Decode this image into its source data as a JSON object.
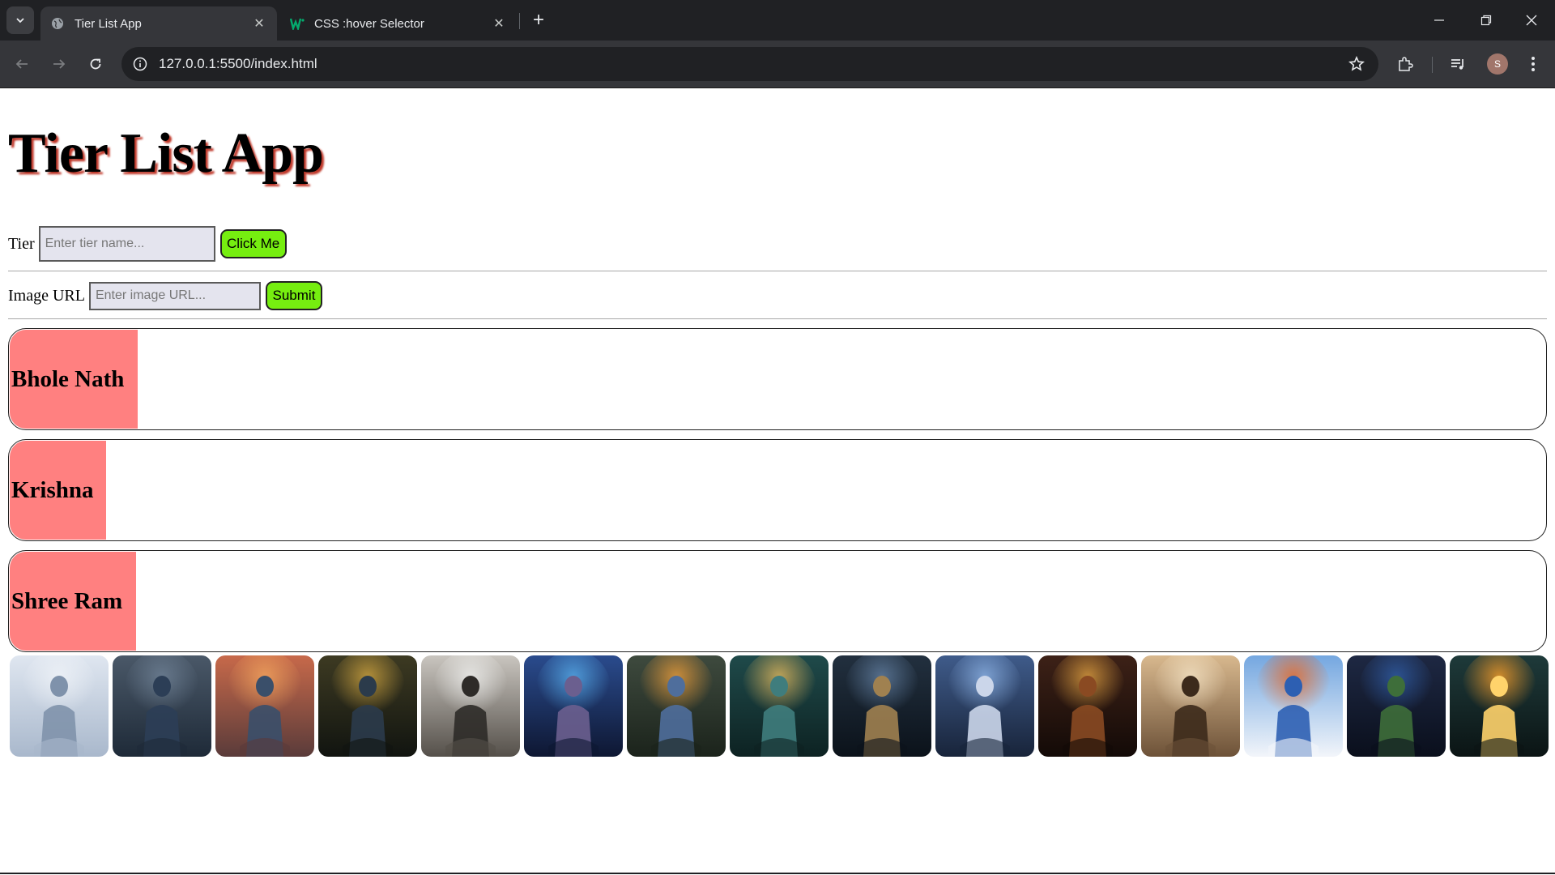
{
  "browser": {
    "tabs": [
      {
        "title": "Tier List App",
        "active": true,
        "favicon": "globe-icon"
      },
      {
        "title": "CSS :hover Selector",
        "active": false,
        "favicon": "w3schools-icon"
      }
    ],
    "url": "127.0.0.1:5500/index.html",
    "profile_initial": "S"
  },
  "page": {
    "title": "Tier List App",
    "tier_form": {
      "label": "Tier",
      "placeholder": "Enter tier name...",
      "button": "Click Me"
    },
    "image_form": {
      "label": "Image URL",
      "placeholder": "Enter image URL...",
      "button": "Submit"
    },
    "tiers": [
      {
        "name": "Bhole Nath"
      },
      {
        "name": "Krishna"
      },
      {
        "name": "Shree Ram"
      }
    ],
    "images": [
      {
        "subject": "shiva-white-meditation"
      },
      {
        "subject": "shiva-trident-meditation"
      },
      {
        "subject": "shiva-fire-orange"
      },
      {
        "subject": "shiva-golden-halo"
      },
      {
        "subject": "shiva-grayscale-tree"
      },
      {
        "subject": "shiva-cosmic-blue"
      },
      {
        "subject": "krishna-flute-orange"
      },
      {
        "subject": "krishna-chakra-teal"
      },
      {
        "subject": "krishna-dark-blue"
      },
      {
        "subject": "krishna-flute-blue"
      },
      {
        "subject": "ram-golden-crown"
      },
      {
        "subject": "ram-temple-bow"
      },
      {
        "subject": "ram-sky-clouds"
      },
      {
        "subject": "ram-bow-dark"
      },
      {
        "subject": "ram-sunset-silhouette"
      }
    ],
    "colors": {
      "tier_label_bg": "#ff8080",
      "button_bg": "#76ee10",
      "title_shadow": "#c0392b"
    }
  }
}
